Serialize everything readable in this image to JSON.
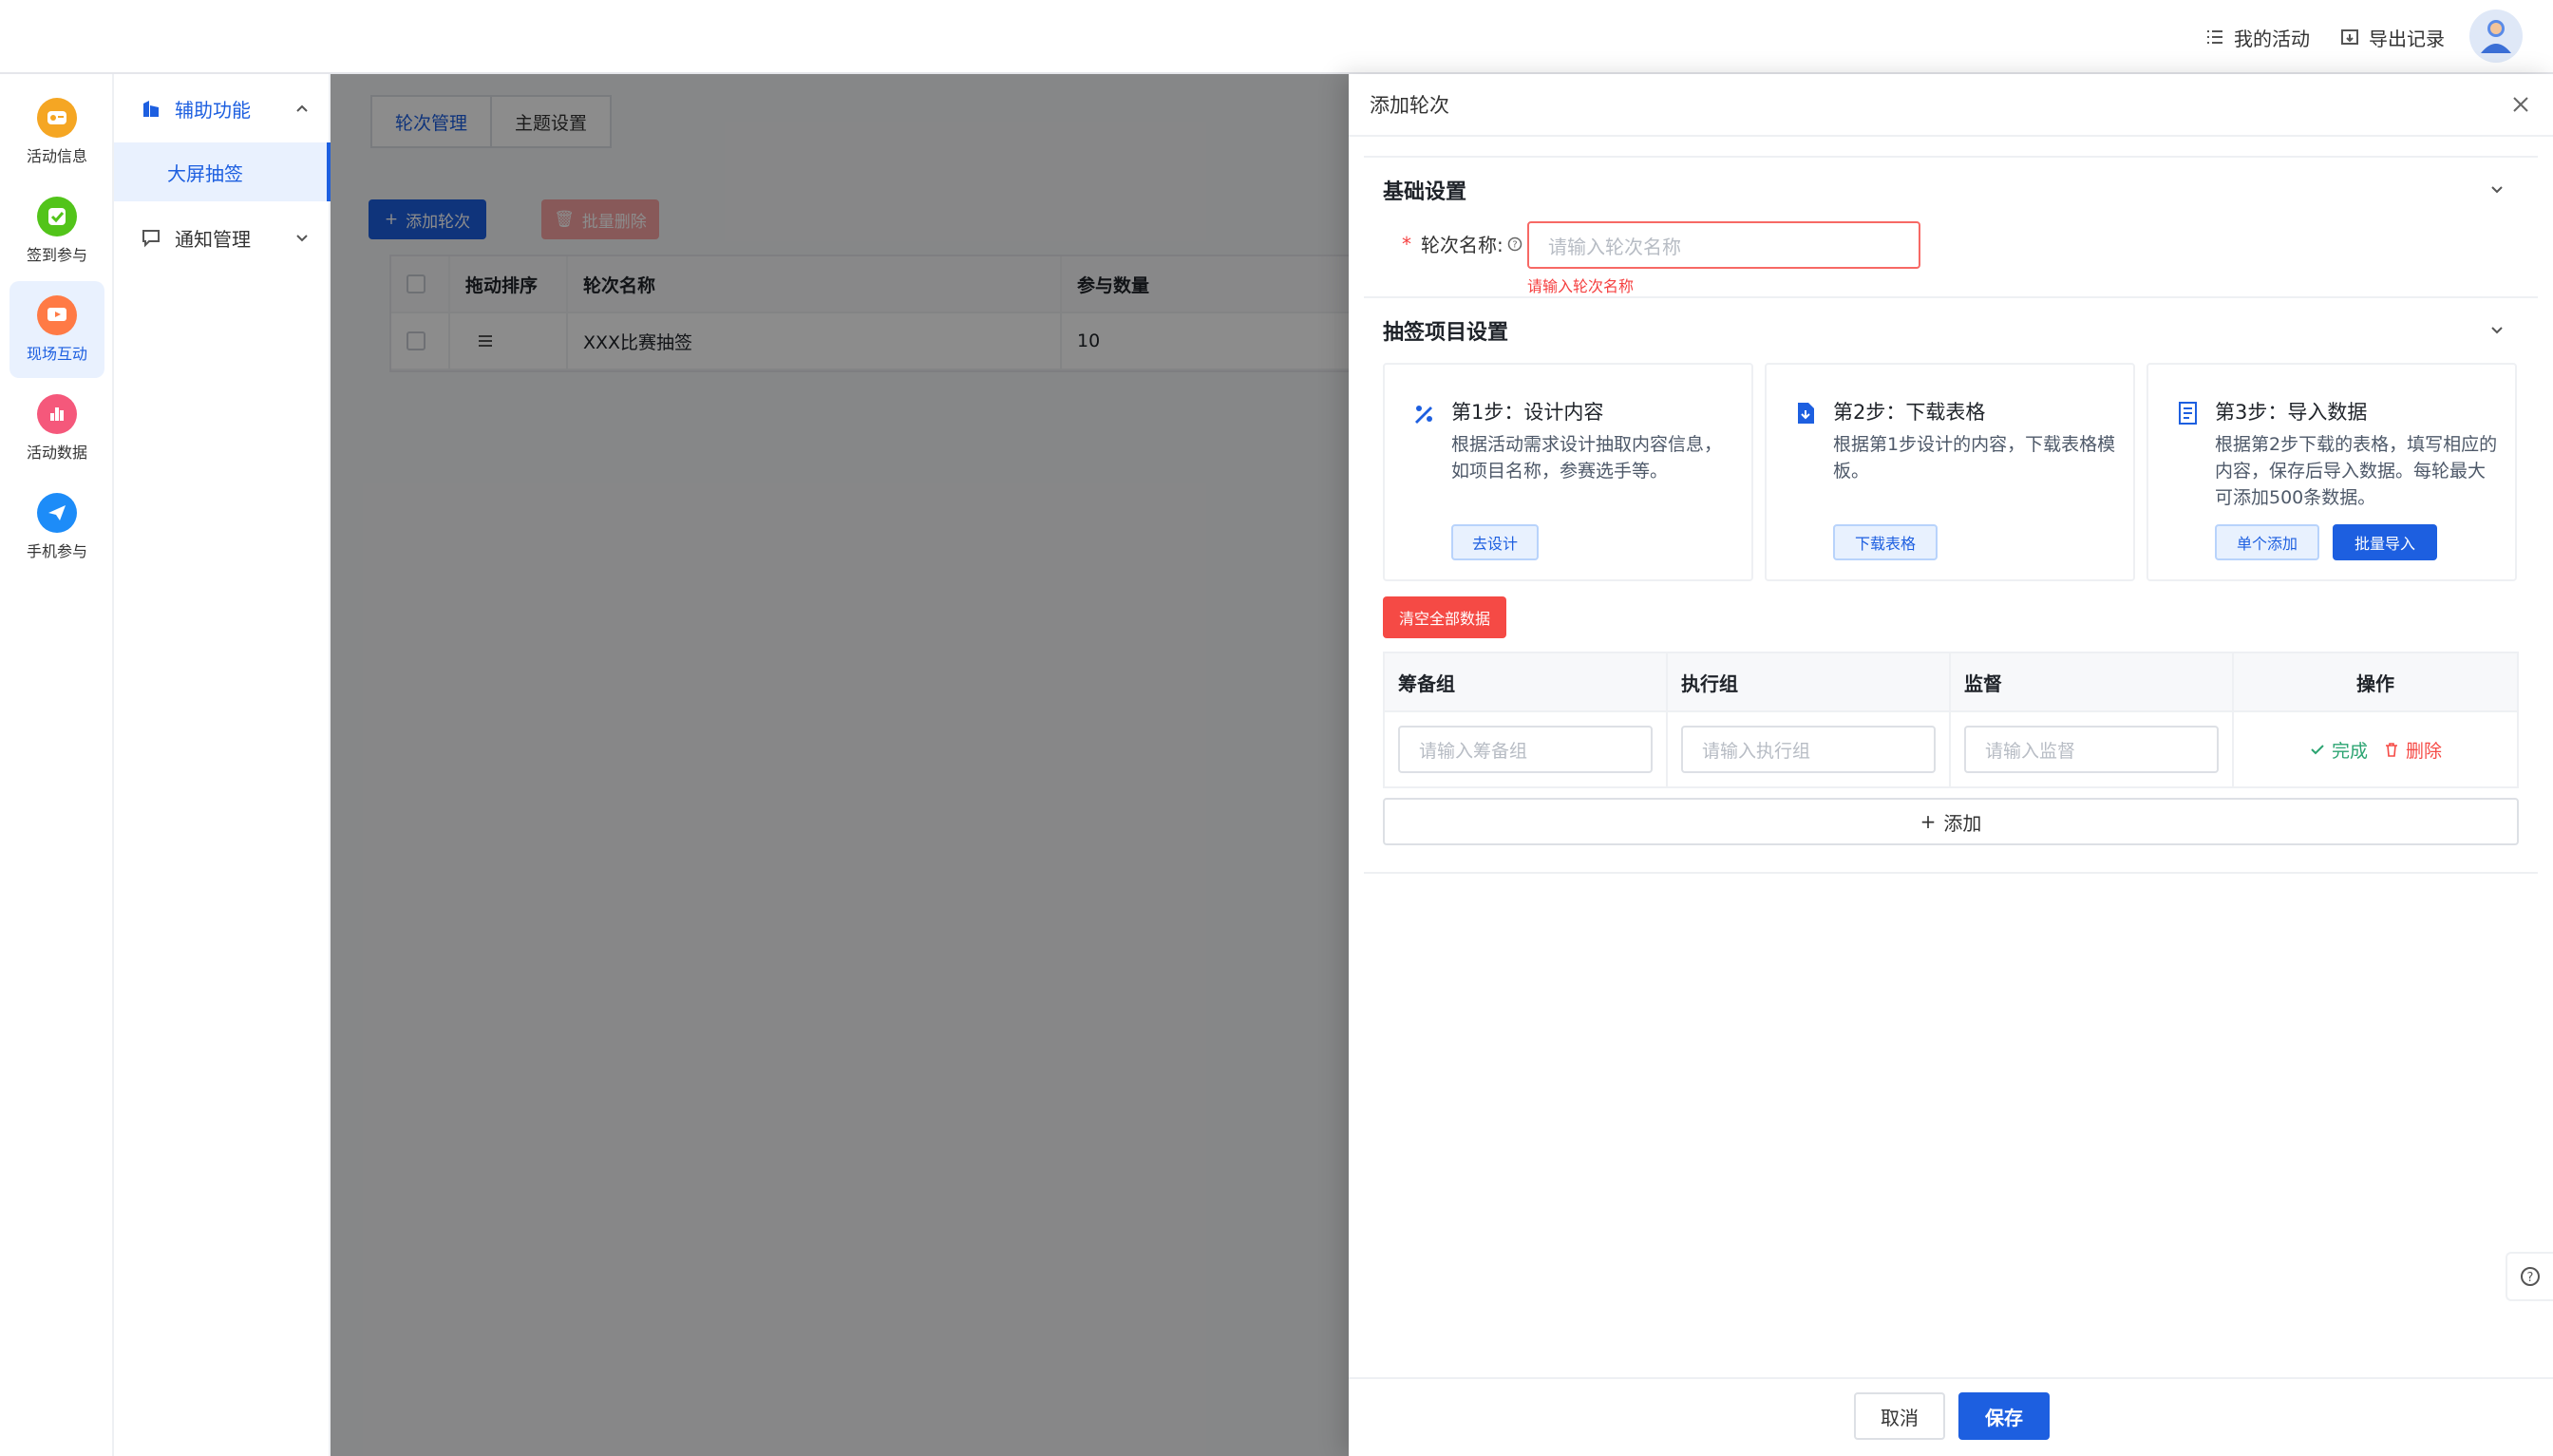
{
  "header": {
    "my_activity": "我的活动",
    "export_records": "导出记录"
  },
  "rail": {
    "items": [
      {
        "label": "活动信息",
        "icon": "activity-info-icon",
        "color": "#f5a623"
      },
      {
        "label": "签到参与",
        "icon": "checkin-icon",
        "color": "#52c41a"
      },
      {
        "label": "现场互动",
        "icon": "interaction-icon",
        "color": "#ff7a45"
      },
      {
        "label": "活动数据",
        "icon": "data-icon",
        "color": "#f5587b"
      },
      {
        "label": "手机参与",
        "icon": "mobile-icon",
        "color": "#1d8cf8"
      }
    ],
    "active_index": 2
  },
  "submenu": {
    "group1": "辅助功能",
    "group1_sub": "大屏抽签",
    "group2": "通知管理"
  },
  "main": {
    "tabs": [
      "轮次管理",
      "主题设置"
    ],
    "add_round": "添加轮次",
    "batch_delete": "批量删除",
    "table": {
      "headers": [
        "拖动排序",
        "轮次名称",
        "参与数量"
      ],
      "rows": [
        {
          "name": "XXX比赛抽签",
          "count": "10"
        }
      ]
    }
  },
  "drawer": {
    "title": "添加轮次",
    "basic_section": "基础设置",
    "round_name_label": "轮次名称:",
    "round_name_placeholder": "请输入轮次名称",
    "round_name_error": "请输入轮次名称",
    "draw_section": "抽签项目设置",
    "steps": [
      {
        "title": "第1步：设计内容",
        "desc": "根据活动需求设计抽取内容信息，如项目名称，参赛选手等。",
        "buttons": [
          "去设计"
        ]
      },
      {
        "title": "第2步：下载表格",
        "desc": "根据第1步设计的内容，下载表格模板。",
        "buttons": [
          "下载表格"
        ]
      },
      {
        "title": "第3步：导入数据",
        "desc": "根据第2步下载的表格，填写相应的内容，保存后导入数据。每轮最大可添加500条数据。",
        "buttons": [
          "单个添加",
          "批量导入"
        ]
      }
    ],
    "clear_all": "清空全部数据",
    "table": {
      "headers": [
        "筹备组",
        "执行组",
        "监督",
        "操作"
      ],
      "placeholders": [
        "请输入筹备组",
        "请输入执行组",
        "请输入监督"
      ],
      "done": "完成",
      "delete": "删除"
    },
    "add_row": "添加",
    "cancel": "取消",
    "save": "保存"
  },
  "colors": {
    "primary": "#1d5fe0",
    "danger": "#f54a45",
    "success": "#2ba471"
  }
}
